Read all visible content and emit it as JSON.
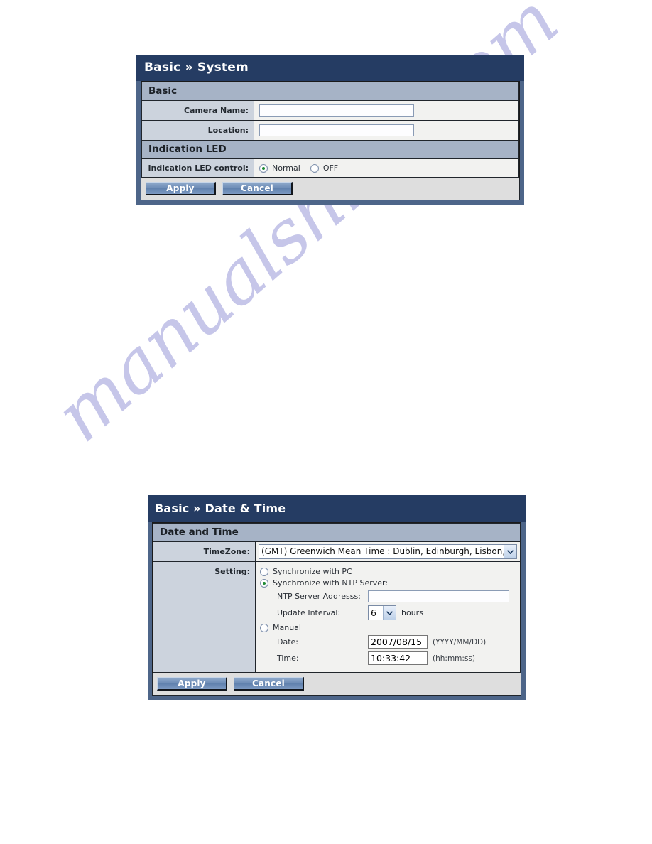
{
  "watermark": {
    "text": "manualshive.com"
  },
  "colors": {
    "titlebar": "#253c63",
    "panel_frame": "#4d6589",
    "section_header": "#a6b3c6",
    "label_cell": "#ccd3dd",
    "value_cell": "#f2f2f0",
    "footer_bg": "#dedede",
    "radio_selected_dot": "#1d8a33",
    "button_text": "#ffffff"
  },
  "panels": [
    {
      "id": "system",
      "title": "Basic » System",
      "sections": [
        {
          "header": "Basic",
          "rows": [
            {
              "label": "Camera Name:",
              "value": "",
              "placeholder": ""
            },
            {
              "label": "Location:",
              "value": "",
              "placeholder": ""
            }
          ]
        },
        {
          "header": "Indication LED",
          "led_label": "Indication LED control:",
          "options": [
            {
              "label": "Normal",
              "selected": true
            },
            {
              "label": "OFF",
              "selected": false
            }
          ]
        }
      ],
      "footer": {
        "apply_label": "Apply",
        "cancel_label": "Cancel"
      }
    },
    {
      "id": "datetime",
      "title": "Basic » Date & Time",
      "section_header": "Date and Time",
      "timezone": {
        "label": "TimeZone:",
        "selected": "(GMT) Greenwich Mean Time : Dublin, Edinburgh, Lisbon, London"
      },
      "setting": {
        "label": "Setting:",
        "options": [
          {
            "label": "Synchronize with PC",
            "selected": false
          },
          {
            "label": "Synchronize with NTP Server:",
            "selected": true
          },
          {
            "label": "Manual",
            "selected": false
          }
        ],
        "ntp_server": {
          "label": "NTP Server Addresss:",
          "value": "",
          "placeholder": ""
        },
        "update_interval": {
          "label": "Update Interval:",
          "selected": "6",
          "unit": "hours"
        },
        "manual_date": {
          "label": "Date:",
          "value": "2007/08/15",
          "hint": "(YYYY/MM/DD)"
        },
        "manual_time": {
          "label": "Time:",
          "value": "10:33:42",
          "hint": "(hh:mm:ss)"
        }
      },
      "footer": {
        "apply_label": "Apply",
        "cancel_label": "Cancel"
      }
    }
  ]
}
